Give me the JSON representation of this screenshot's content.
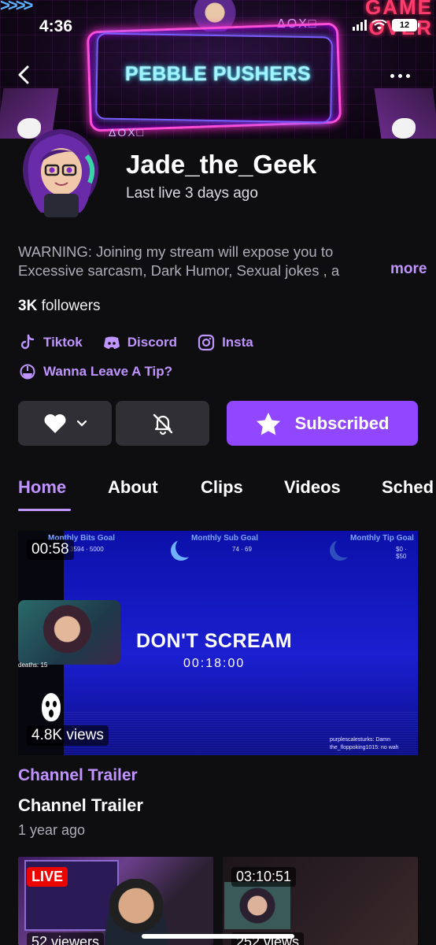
{
  "status_bar": {
    "time": "4:36",
    "battery": "12"
  },
  "banner": {
    "title": "PEBBLE PUSHERS",
    "corner_text": "GAME OVER",
    "symbols": "ΔOX□",
    "accent_color": "#ff4fd8"
  },
  "channel": {
    "name": "Jade_the_Geek",
    "last_live": "Last live 3 days ago",
    "description_line1": "WARNING: Joining my stream will expose you to",
    "description_line2": "Excessive sarcasm, Dark Humor, Sexual jokes , a",
    "more_label": "more",
    "followers_count": "3K",
    "followers_label": " followers"
  },
  "social_links": [
    {
      "label": "Tiktok",
      "icon": "tiktok-icon"
    },
    {
      "label": "Discord",
      "icon": "discord-icon"
    },
    {
      "label": "Insta",
      "icon": "instagram-icon"
    }
  ],
  "tip_link": {
    "label": "Wanna Leave A Tip?",
    "icon": "tip-icon"
  },
  "actions": {
    "subscribe_label": "Subscribed",
    "subscribe_color": "#9147ff"
  },
  "tabs": [
    {
      "label": "Home",
      "active": true
    },
    {
      "label": "About"
    },
    {
      "label": "Clips"
    },
    {
      "label": "Videos"
    },
    {
      "label": "Sched"
    }
  ],
  "trailer": {
    "duration": "00:58",
    "views": "4.8K views",
    "category": "Channel Trailer",
    "title": "Channel Trailer",
    "age": "1 year ago",
    "video": {
      "goal_bits_label": "Monthly Bits Goal",
      "goal_bits_value": "3594 · 5000",
      "goal_sub_label": "Monthly Sub Goal",
      "goal_sub_value": "74 · 69",
      "goal_tip_label": "Monthly Tip Goal",
      "goal_tip_value": "$0 · $50",
      "headline": "DON'T SCREAM",
      "timer": "00:18:00",
      "deaths": "deaths: 15",
      "chat1": "purplescalesturks: Damn",
      "chat2": "the_floppoking1015: no wah"
    }
  },
  "thumbnails": [
    {
      "badge": "LIVE",
      "views": "52 viewers"
    },
    {
      "duration": "03:10:51",
      "views": "252 views"
    }
  ]
}
